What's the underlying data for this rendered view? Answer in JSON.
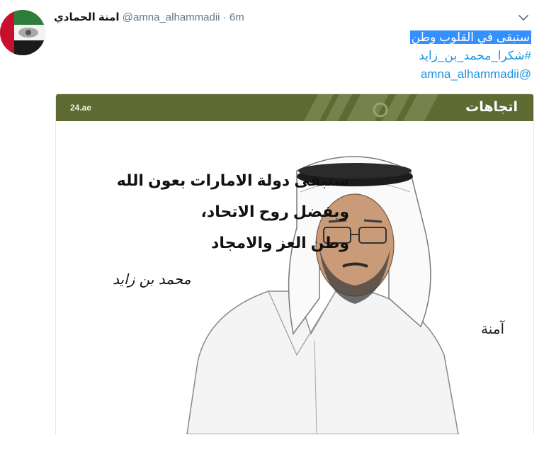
{
  "tweet": {
    "display_name": "امنة الحمادي",
    "handle": "@amna_alhammadii",
    "separator": "·",
    "time": "6m",
    "text_line1": "ستبقى في القلوب وطن",
    "hashtag": "#شكرا_محمد_بن_زايد",
    "mention": "@amna_alhammadii"
  },
  "media": {
    "banner_left": "24.ae",
    "banner_right": "اتجاهات",
    "quote_lines": [
      "ستبقى دولة الامارات بعون الله",
      "وبفضل روح الاتحاد،",
      "وطن العز والامجاد"
    ],
    "signature": "محمد بن زايد",
    "artist_signature": "آمنة",
    "banner_color": "#5d6a32"
  },
  "colors": {
    "link": "#1b95e0",
    "selection": "#3390ff",
    "muted": "#657786"
  },
  "icons": {
    "menu": "chevron-down-icon",
    "avatar": "uae-flag-avatar"
  }
}
